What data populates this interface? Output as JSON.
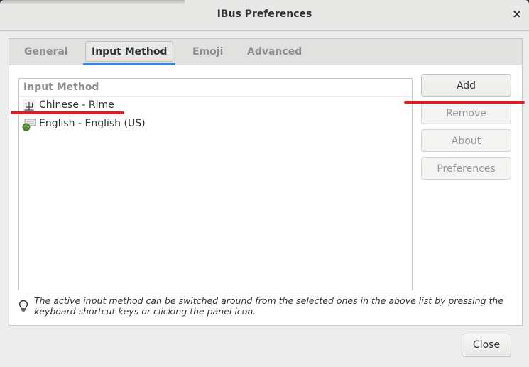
{
  "window": {
    "title": "IBus Preferences",
    "close_glyph": "×"
  },
  "tabs": [
    {
      "label": "General",
      "active": false
    },
    {
      "label": "Input Method",
      "active": true
    },
    {
      "label": "Emoji",
      "active": false
    },
    {
      "label": "Advanced",
      "active": false
    }
  ],
  "input_method_list": {
    "header": "Input Method",
    "items": [
      {
        "label": "Chinese - Rime",
        "icon": "rime-glyph-icon",
        "glyph": "ㄓ"
      },
      {
        "label": "English - English (US)",
        "icon": "keyboard-globe-icon"
      }
    ]
  },
  "actions": {
    "add": {
      "label": "Add",
      "enabled": true
    },
    "remove": {
      "label": "Remove",
      "enabled": false
    },
    "about": {
      "label": "About",
      "enabled": false
    },
    "preferences": {
      "label": "Preferences",
      "enabled": false
    }
  },
  "hint": {
    "icon": "lightbulb-icon",
    "text": "The active input method can be switched around from the selected ones in the above list by pressing the keyboard shortcut keys or clicking the panel icon."
  },
  "footer": {
    "close_label": "Close"
  },
  "colors": {
    "accent": "#3584e4",
    "annotation": "#e01b24"
  }
}
